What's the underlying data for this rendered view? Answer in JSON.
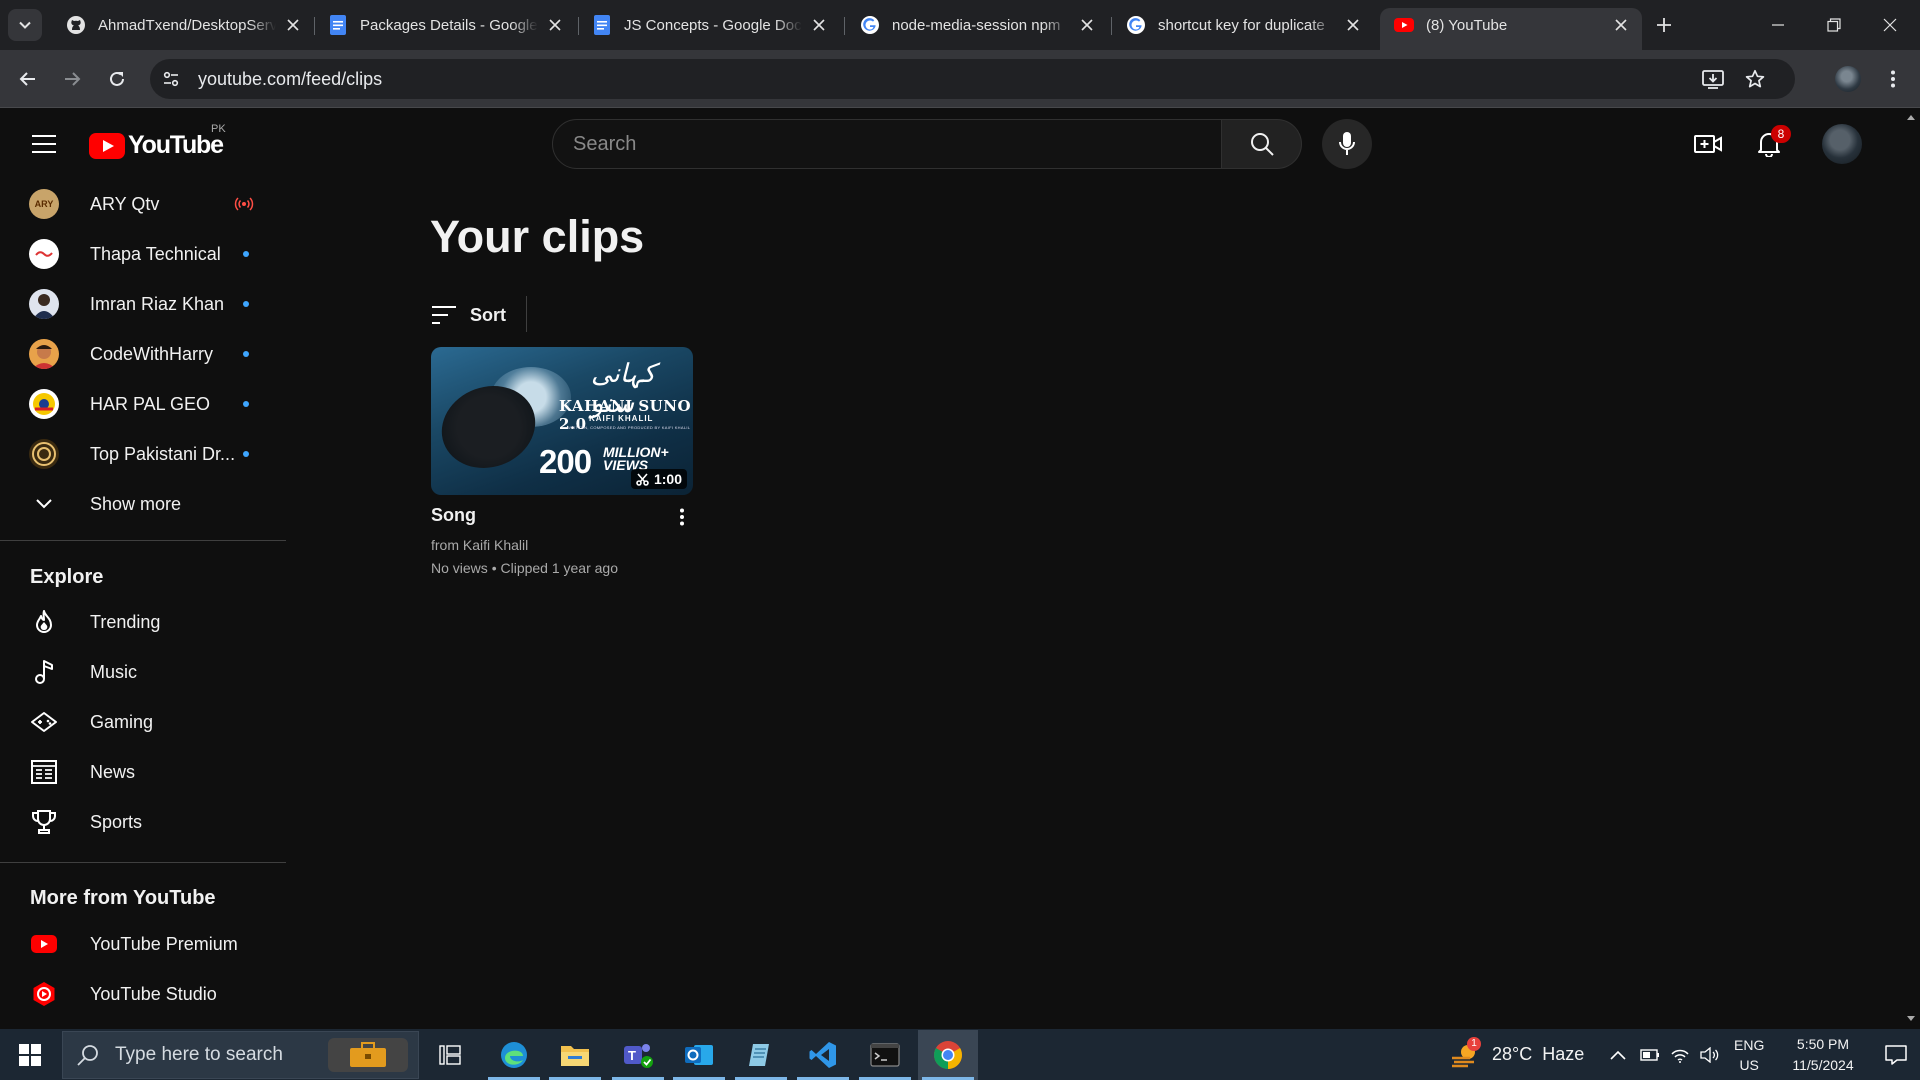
{
  "browser": {
    "tabs": [
      {
        "title": "AhmadTxend/DesktopServ",
        "icon": "github-icon"
      },
      {
        "title": "Packages Details - Google",
        "icon": "google-docs-icon"
      },
      {
        "title": "JS Concepts - Google Docs",
        "icon": "google-docs-icon"
      },
      {
        "title": "node-media-session npm",
        "icon": "google-icon"
      },
      {
        "title": "shortcut key for duplicate",
        "icon": "google-icon"
      },
      {
        "title": "(8) YouTube",
        "icon": "youtube-icon",
        "active": true
      }
    ],
    "url": "youtube.com/feed/clips"
  },
  "masthead": {
    "logo_text": "YouTube",
    "country_code": "PK",
    "search_placeholder": "Search",
    "notification_count": "8"
  },
  "sidebar": {
    "subscriptions": [
      {
        "name": "ARY Qtv",
        "status": "live",
        "avatar_text": "ARY",
        "avatar_color": "#c8a46a"
      },
      {
        "name": "Thapa Technical",
        "status": "new",
        "avatar_text": "",
        "avatar_color": "#ffffff"
      },
      {
        "name": "Imran Riaz Khan",
        "status": "new",
        "avatar_text": "",
        "avatar_color": "#2a3a5a"
      },
      {
        "name": "CodeWithHarry",
        "status": "new",
        "avatar_text": "",
        "avatar_color": "#e8a24a"
      },
      {
        "name": "HAR PAL GEO",
        "status": "new",
        "avatar_text": "",
        "avatar_color": "#f5c800"
      },
      {
        "name": "Top Pakistani Dr...",
        "status": "new",
        "avatar_text": "",
        "avatar_color": "#3a2a10"
      }
    ],
    "show_more": "Show more",
    "explore_heading": "Explore",
    "explore": [
      {
        "label": "Trending",
        "icon": "trending-icon"
      },
      {
        "label": "Music",
        "icon": "music-icon"
      },
      {
        "label": "Gaming",
        "icon": "gaming-icon"
      },
      {
        "label": "News",
        "icon": "news-icon"
      },
      {
        "label": "Sports",
        "icon": "sports-trophy-icon"
      }
    ],
    "more_heading": "More from YouTube",
    "more": [
      {
        "label": "YouTube Premium",
        "icon": "youtube-premium-icon"
      },
      {
        "label": "YouTube Studio",
        "icon": "youtube-studio-icon"
      }
    ]
  },
  "main": {
    "title": "Your clips",
    "sort_label": "Sort",
    "clips": [
      {
        "title": "Song",
        "from": "from Kaifi Khalil",
        "views": "No views",
        "clipped": "Clipped 1 year ago",
        "duration": "1:00",
        "thumb": {
          "urdu": "کہانی سنو",
          "line1": "KAHANI SUNO 2.0",
          "line2": "KAIFI KHALIL",
          "line3": "WRITTEN, COMPOSED AND PRODUCED BY KAIFI KHALIL",
          "big": "200",
          "million": "MILLION+",
          "views_word": "VIEWS"
        }
      }
    ]
  },
  "taskbar": {
    "search_placeholder": "Type here to search",
    "weather": "28°C  Haze",
    "weather_badge": "1",
    "lang_top": "ENG",
    "lang_bottom": "US",
    "time": "5:50 PM",
    "date": "11/5/2024"
  },
  "colors": {
    "youtube_red": "#ff0000",
    "link_blue_dot": "#3ea6ff",
    "bg": "#0f0f0f"
  }
}
